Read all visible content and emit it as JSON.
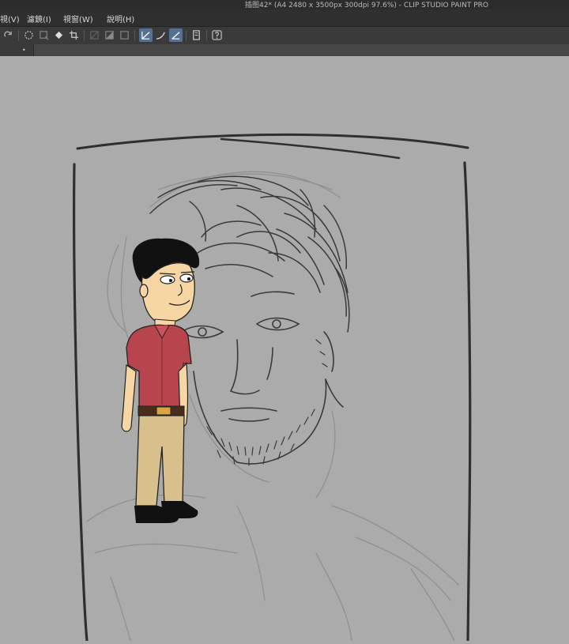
{
  "window": {
    "title": "插图42* (A4 2480 x 3500px 300dpi 97.6%)  - CLIP STUDIO PAINT PRO"
  },
  "menubar": {
    "items": [
      {
        "label": "視(V)"
      },
      {
        "label": "濾鏡(I)"
      },
      {
        "label": "視窗(W)"
      },
      {
        "label": "說明(H)"
      }
    ]
  },
  "toolbar": {
    "buttons": [
      {
        "icon": "redo-icon"
      },
      {
        "icon": "marquee-icon"
      },
      {
        "icon": "transform-icon"
      },
      {
        "icon": "fill-icon"
      },
      {
        "icon": "crop-icon"
      },
      {
        "icon": "hide-selection-icon"
      },
      {
        "icon": "fill-selection-icon"
      },
      {
        "icon": "clear-selection-icon"
      },
      {
        "icon": "snap-to-ruler-icon",
        "active": true
      },
      {
        "icon": "snap-to-special-ruler-icon"
      },
      {
        "icon": "snap-to-grid-icon",
        "active": true
      },
      {
        "icon": "tablet-icon"
      },
      {
        "icon": "help-icon"
      }
    ]
  },
  "tabs": [
    {
      "indicator": "•"
    }
  ],
  "colors": {
    "canvas_bg": "#ababab",
    "title_bg": "#2c2c2c",
    "menu_bg": "#2f2f2f",
    "toolbar_bg": "#3a3a3a",
    "active_button": "#56718f",
    "shirt": "#b8444e",
    "pants": "#d8c08c"
  }
}
